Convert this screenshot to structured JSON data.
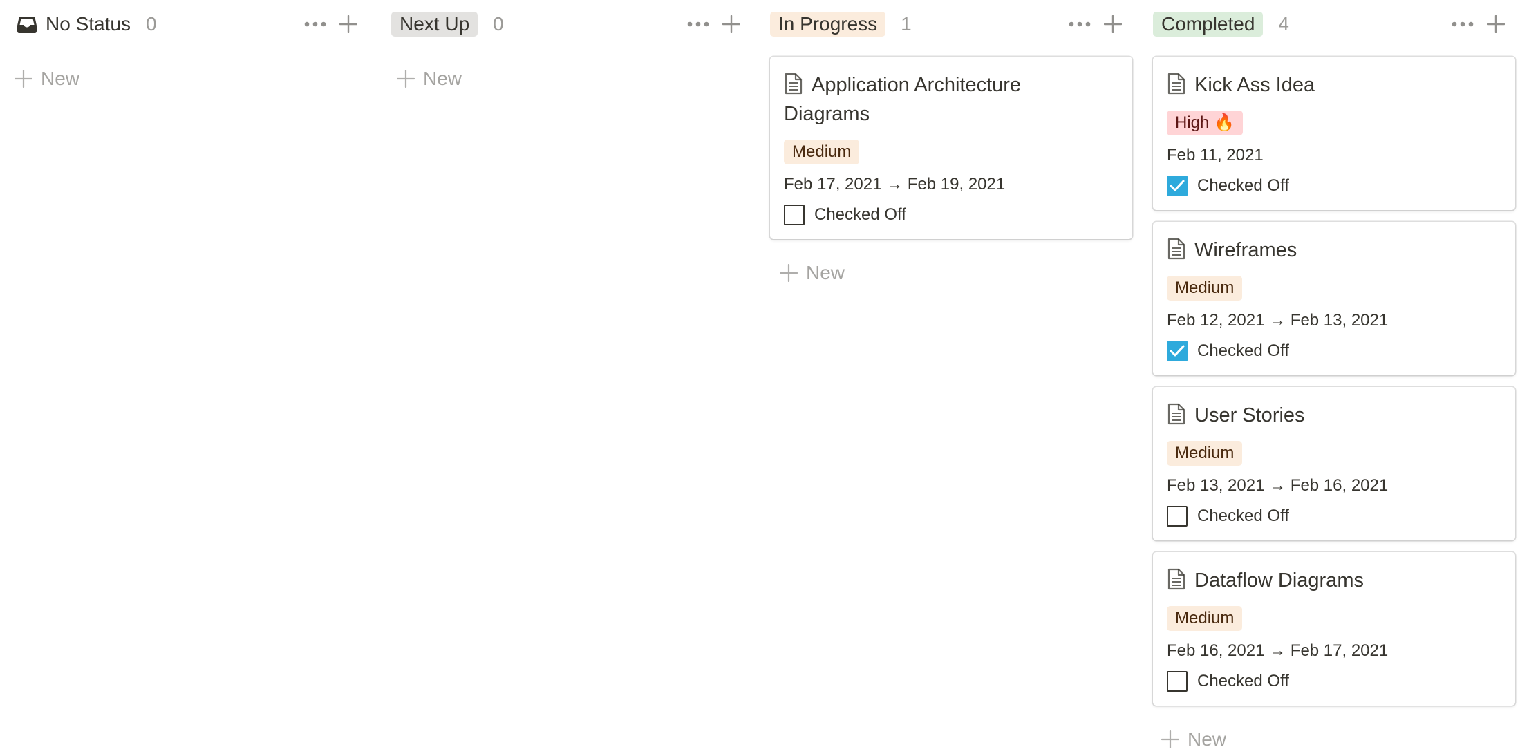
{
  "columns": [
    {
      "status": "No Status",
      "count": "0",
      "new_label": "New",
      "cards": []
    },
    {
      "status": "Next Up",
      "count": "0",
      "color": "#e3e2e0",
      "new_label": "New",
      "cards": []
    },
    {
      "status": "In Progress",
      "count": "1",
      "color": "#fbecdd",
      "new_label": "New",
      "cards": [
        {
          "title": "Application Architecture Diagrams",
          "priority": "Medium",
          "date": "Feb 17, 2021 → Feb 19, 2021",
          "checkbox_label": "Checked Off",
          "checked": false
        }
      ]
    },
    {
      "status": "Completed",
      "count": "4",
      "color": "#dbeddb",
      "new_label": "New",
      "cards": [
        {
          "title": "Kick Ass Idea",
          "priority": "High 🔥",
          "date": "Feb 11, 2021",
          "checkbox_label": "Checked Off",
          "checked": true
        },
        {
          "title": "Wireframes",
          "priority": "Medium",
          "date": "Feb 12, 2021 → Feb 13, 2021",
          "checkbox_label": "Checked Off",
          "checked": true
        },
        {
          "title": "User Stories",
          "priority": "Medium",
          "date": "Feb 13, 2021 → Feb 16, 2021",
          "checkbox_label": "Checked Off",
          "checked": false
        },
        {
          "title": "Dataflow Diagrams",
          "priority": "Medium",
          "date": "Feb 16, 2021 → Feb 17, 2021",
          "checkbox_label": "Checked Off",
          "checked": false
        }
      ]
    }
  ],
  "colors": {
    "medium_tag": "#fbecdd",
    "high_tag": "#ffd4d6",
    "checkbox_checked": "#2eaadc"
  }
}
